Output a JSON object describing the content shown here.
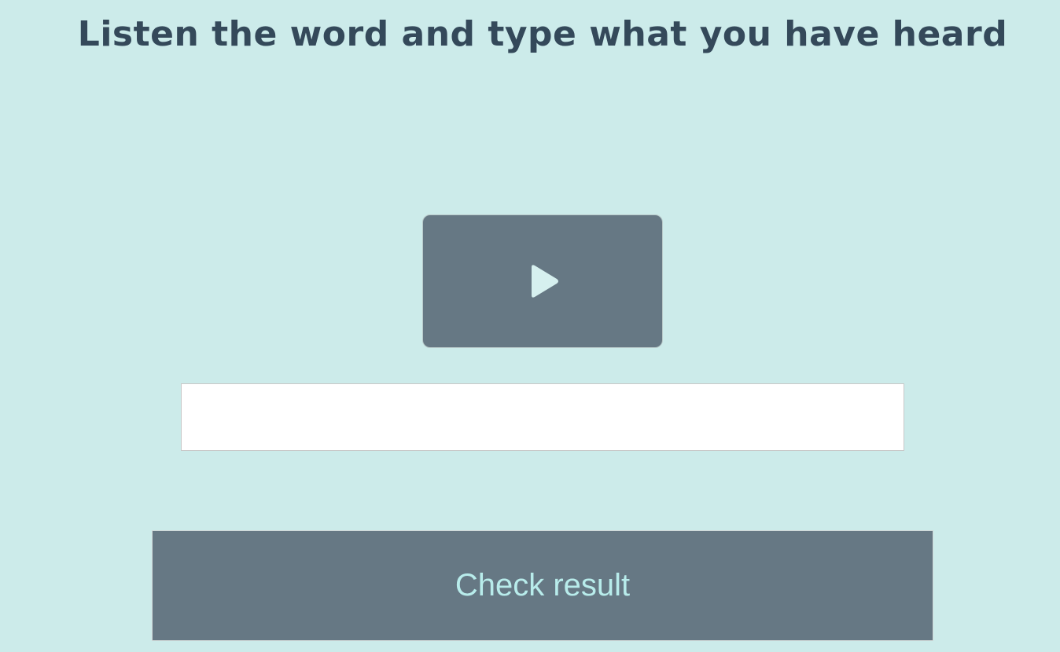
{
  "page": {
    "title": "Listen the word and type what you have heard"
  },
  "player": {
    "icon": "play-icon"
  },
  "answer": {
    "value": "",
    "placeholder": ""
  },
  "actions": {
    "check_label": "Check result"
  },
  "colors": {
    "background": "#ccebea",
    "title": "#34495a",
    "button_bg": "#667884",
    "button_text": "#b8eceb",
    "input_bg": "#ffffff"
  }
}
